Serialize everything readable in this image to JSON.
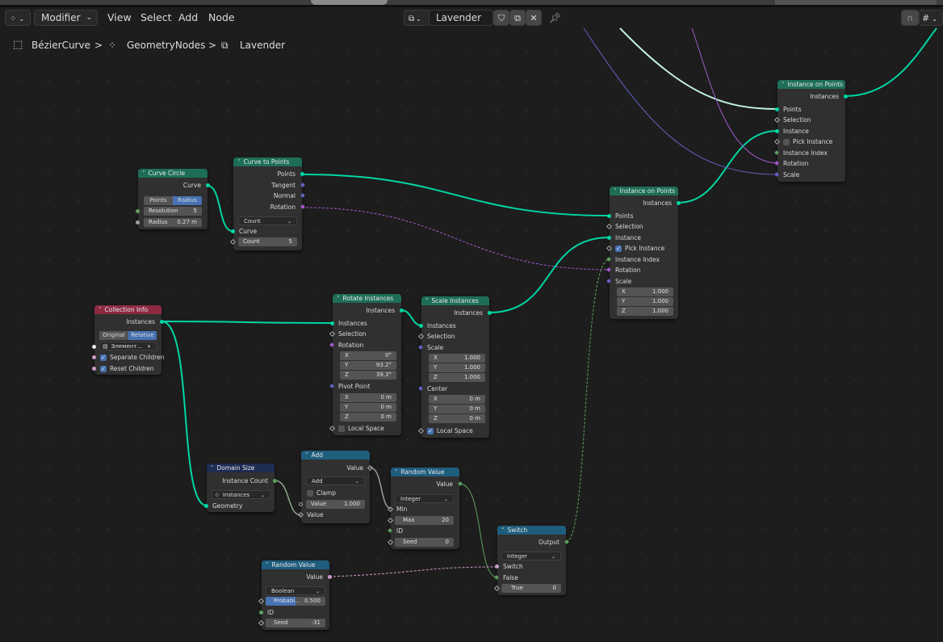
{
  "header": {
    "editor_type_icon": "node-editor-icon",
    "mode_label": "Modifier",
    "menus": [
      "View",
      "Select",
      "Add",
      "Node"
    ],
    "node_tree_icon": "node-tree-icon",
    "node_tree_name": "Lavender",
    "fake_user_icon": "shield-icon",
    "duplicate_icon": "copy-icon",
    "unlink_icon": "close-icon",
    "pin_icon": "pin-icon",
    "snap_icon": "magnet-icon",
    "snap_mode_icon": "snap-grid-icon"
  },
  "breadcrumb": {
    "items": [
      {
        "icon": "curve-object-icon",
        "label": "BézierCurve"
      },
      {
        "icon": "geometry-nodes-icon",
        "label": "GeometryNodes"
      },
      {
        "icon": "node-tree-icon",
        "label": "Lavender"
      }
    ],
    "separator": ">"
  },
  "nodes": {
    "curve_circle": {
      "title": "Curve Circle",
      "output": "Curve",
      "mode_options": [
        "Points",
        "Radius"
      ],
      "mode_selected": "Radius",
      "resolution_label": "Resolution",
      "resolution_value": "5",
      "radius_label": "Radius",
      "radius_value": "0.27 m"
    },
    "curve_to_points": {
      "title": "Curve to Points",
      "outputs": [
        "Points",
        "Tangent",
        "Normal",
        "Rotation"
      ],
      "mode": "Count",
      "input_curve": "Curve",
      "count_label": "Count",
      "count_value": "5"
    },
    "collection_info": {
      "title": "Collection Info",
      "output": "Instances",
      "transform_options": [
        "Original",
        "Relative"
      ],
      "transform_selected": "Relative",
      "collection": "Элемент...",
      "separate_children_label": "Separate Children",
      "separate_children": true,
      "reset_children_label": "Reset Children",
      "reset_children": true
    },
    "rotate_instances": {
      "title": "Rotate Instances",
      "output": "Instances",
      "inputs": {
        "instances": "Instances",
        "selection": "Selection",
        "rotation": "Rotation",
        "pivot": "Pivot Point",
        "local_space": "Local Space"
      },
      "rotation": {
        "X": "0°",
        "Y": "93.2°",
        "Z": "39.3°"
      },
      "pivot": {
        "X": "0 m",
        "Y": "0 m",
        "Z": "0 m"
      },
      "local_space_checked": false
    },
    "scale_instances": {
      "title": "Scale Instances",
      "output": "Instances",
      "inputs": {
        "instances": "Instances",
        "selection": "Selection",
        "scale": "Scale",
        "center": "Center",
        "local_space": "Local Space"
      },
      "scale": {
        "X": "1.000",
        "Y": "1.000",
        "Z": "1.000"
      },
      "center": {
        "X": "0 m",
        "Y": "0 m",
        "Z": "0 m"
      },
      "local_space_checked": true
    },
    "instance_on_points_1": {
      "title": "Instance on Points",
      "output": "Instances",
      "inputs": {
        "points": "Points",
        "selection": "Selection",
        "instance": "Instance",
        "pick_instance": "Pick Instance",
        "instance_index": "Instance Index",
        "rotation": "Rotation",
        "scale": "Scale"
      },
      "pick_instance_checked": true,
      "scale": {
        "X": "1.000",
        "Y": "1.000",
        "Z": "1.000"
      }
    },
    "instance_on_points_2": {
      "title": "Instance on Points",
      "output": "Instances",
      "inputs": {
        "points": "Points",
        "selection": "Selection",
        "instance": "Instance",
        "pick_instance": "Pick Instance",
        "instance_index": "Instance Index",
        "rotation": "Rotation",
        "scale": "Scale"
      },
      "pick_instance_checked": false
    },
    "domain_size": {
      "title": "Domain Size",
      "output": "Instance Count",
      "component": "Instances",
      "input": "Geometry"
    },
    "add": {
      "title": "Add",
      "output": "Value",
      "operation": "Add",
      "clamp_label": "Clamp",
      "clamp": false,
      "value_label": "Value",
      "value": "1.000",
      "input2": "Value"
    },
    "random_value_int": {
      "title": "Random Value",
      "output": "Value",
      "data_type": "Integer",
      "min_label": "Min",
      "max_label": "Max",
      "max_value": "20",
      "id_label": "ID",
      "seed_label": "Seed",
      "seed_value": "0"
    },
    "random_value_bool": {
      "title": "Random Value",
      "output": "Value",
      "data_type": "Boolean",
      "probability_label": "Probabi...",
      "probability_value": "0.500",
      "probability": 0.5,
      "id_label": "ID",
      "seed_label": "Seed",
      "seed_value": "-31"
    },
    "switch": {
      "title": "Switch",
      "output": "Output",
      "data_type": "Integer",
      "switch_label": "Switch",
      "false_label": "False",
      "true_label": "True",
      "true_value": "0"
    }
  },
  "colors": {
    "geometry_socket": "#00d6a3",
    "rotation_socket": "#a25bd0",
    "vector_socket": "#6363c7",
    "integer_socket": "#5fa15f",
    "boolean_socket": "#cc9cc9",
    "geometry_header": "#1e6e57",
    "input_header": "#8c2a42",
    "utility_header": "#1f5d7d",
    "attribute_header": "#1e2b52"
  }
}
